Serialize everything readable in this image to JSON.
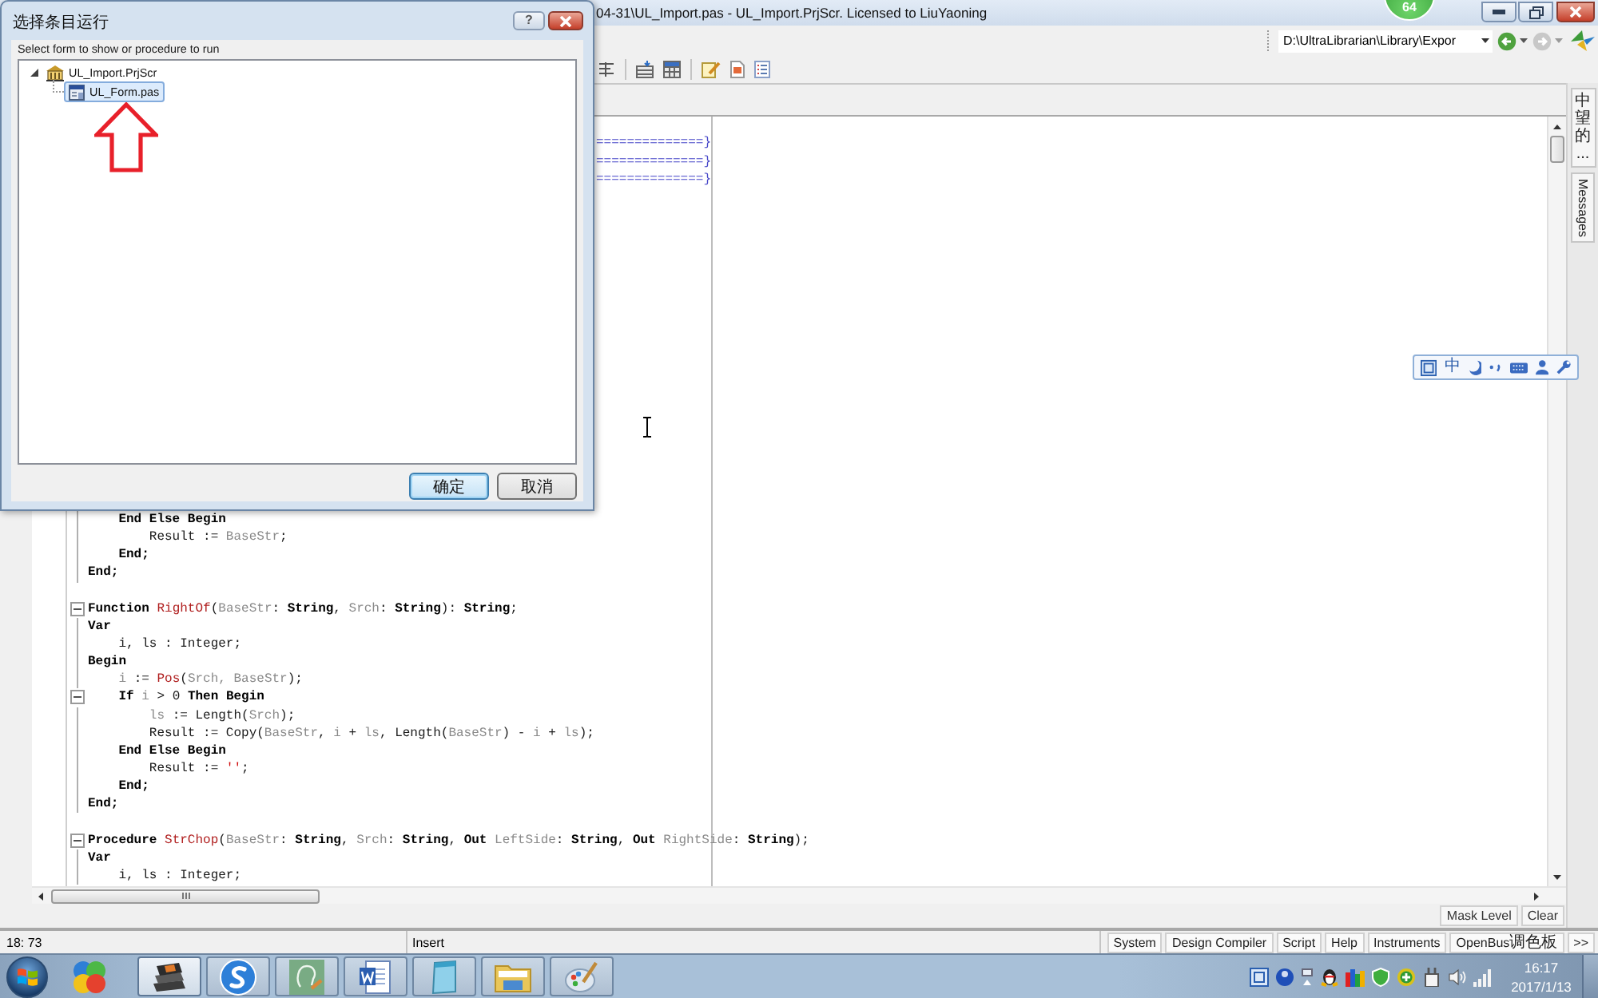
{
  "dialog": {
    "title": "选择条目运行",
    "help_button": "?",
    "prompt": "Select form to show or procedure to run",
    "tree": [
      {
        "label": "UL_Import.PrjScr",
        "expanded": true,
        "selected": false,
        "children": [
          {
            "label": "UL_Form.pas",
            "selected": true
          }
        ]
      }
    ],
    "buttons": [
      {
        "label": "确定",
        "default": true
      },
      {
        "label": "取消",
        "default": false
      }
    ]
  },
  "window": {
    "title": "04-31\\UL_Import.pas - UL_Import.PrjScr. Licensed to LiuYaoning"
  },
  "floating_badge": "64",
  "toolbar": {
    "path_field": {
      "value": "D:\\UltraLibrarian\\Library\\Expor"
    }
  },
  "editor": {
    "fragments": [
      "==============}",
      "==============}",
      "==============}"
    ],
    "blocks": [
      [
        {
          "fold": false,
          "tokens": [
            {
              "kind": "keyword",
              "text": "    End Else Begin"
            }
          ]
        },
        {
          "fold": false,
          "tokens": [
            {
              "kind": "plain",
              "text": "        Result := "
            },
            {
              "kind": "identifier",
              "text": "BaseStr"
            },
            {
              "kind": "plain",
              "text": ";"
            }
          ]
        },
        {
          "fold": false,
          "tokens": [
            {
              "kind": "keyword",
              "text": "    End;"
            }
          ]
        },
        {
          "fold": false,
          "tokens": [
            {
              "kind": "keyword",
              "text": "End;"
            }
          ]
        }
      ],
      [
        {
          "fold": true,
          "tokens": [
            {
              "kind": "keyword",
              "text": "Function "
            },
            {
              "kind": "function",
              "text": "RightOf"
            },
            {
              "kind": "plain",
              "text": "("
            },
            {
              "kind": "identifier",
              "text": "BaseStr"
            },
            {
              "kind": "plain",
              "text": ": "
            },
            {
              "kind": "keyword",
              "text": "String"
            },
            {
              "kind": "plain",
              "text": ", "
            },
            {
              "kind": "identifier",
              "text": "Srch"
            },
            {
              "kind": "plain",
              "text": ": "
            },
            {
              "kind": "keyword",
              "text": "String"
            },
            {
              "kind": "plain",
              "text": "): "
            },
            {
              "kind": "keyword",
              "text": "String"
            },
            {
              "kind": "plain",
              "text": ";"
            }
          ]
        },
        {
          "fold": false,
          "tokens": [
            {
              "kind": "keyword",
              "text": "Var"
            }
          ]
        },
        {
          "fold": false,
          "tokens": [
            {
              "kind": "plain",
              "text": "    i, ls : Integer;"
            }
          ]
        },
        {
          "fold": false,
          "tokens": [
            {
              "kind": "keyword",
              "text": "Begin"
            }
          ]
        },
        {
          "fold": false,
          "tokens": [
            {
              "kind": "identifier",
              "text": "    i"
            },
            {
              "kind": "plain",
              "text": " := "
            },
            {
              "kind": "function",
              "text": "Pos"
            },
            {
              "kind": "plain",
              "text": "("
            },
            {
              "kind": "identifier",
              "text": "Srch, BaseStr"
            },
            {
              "kind": "plain",
              "text": ");"
            }
          ]
        },
        {
          "fold": true,
          "tokens": [
            {
              "kind": "keyword",
              "text": "    If "
            },
            {
              "kind": "identifier",
              "text": "i"
            },
            {
              "kind": "plain",
              "text": " > 0 "
            },
            {
              "kind": "keyword",
              "text": "Then Begin"
            }
          ]
        },
        {
          "fold": false,
          "tokens": [
            {
              "kind": "identifier",
              "text": "        ls"
            },
            {
              "kind": "plain",
              "text": " := Length("
            },
            {
              "kind": "identifier",
              "text": "Srch"
            },
            {
              "kind": "plain",
              "text": ");"
            }
          ]
        },
        {
          "fold": false,
          "tokens": [
            {
              "kind": "plain",
              "text": "        Result := Copy("
            },
            {
              "kind": "identifier",
              "text": "BaseStr"
            },
            {
              "kind": "plain",
              "text": ", "
            },
            {
              "kind": "identifier",
              "text": "i"
            },
            {
              "kind": "plain",
              "text": " + "
            },
            {
              "kind": "identifier",
              "text": "ls"
            },
            {
              "kind": "plain",
              "text": ", Length("
            },
            {
              "kind": "identifier",
              "text": "BaseStr"
            },
            {
              "kind": "plain",
              "text": ") - "
            },
            {
              "kind": "identifier",
              "text": "i"
            },
            {
              "kind": "plain",
              "text": " + "
            },
            {
              "kind": "identifier",
              "text": "ls"
            },
            {
              "kind": "plain",
              "text": ");"
            }
          ]
        },
        {
          "fold": false,
          "tokens": [
            {
              "kind": "keyword",
              "text": "    End Else Begin"
            }
          ]
        },
        {
          "fold": false,
          "tokens": [
            {
              "kind": "plain",
              "text": "        Result := "
            },
            {
              "kind": "string",
              "text": "''"
            },
            {
              "kind": "plain",
              "text": ";"
            }
          ]
        },
        {
          "fold": false,
          "tokens": [
            {
              "kind": "keyword",
              "text": "    End;"
            }
          ]
        },
        {
          "fold": false,
          "tokens": [
            {
              "kind": "keyword",
              "text": "End;"
            }
          ]
        }
      ],
      [
        {
          "fold": true,
          "tokens": [
            {
              "kind": "keyword",
              "text": "Procedure "
            },
            {
              "kind": "function",
              "text": "StrChop"
            },
            {
              "kind": "plain",
              "text": "("
            },
            {
              "kind": "identifier",
              "text": "BaseStr"
            },
            {
              "kind": "plain",
              "text": ": "
            },
            {
              "kind": "keyword",
              "text": "String"
            },
            {
              "kind": "plain",
              "text": ", "
            },
            {
              "kind": "identifier",
              "text": "Srch"
            },
            {
              "kind": "plain",
              "text": ": "
            },
            {
              "kind": "keyword",
              "text": "String"
            },
            {
              "kind": "plain",
              "text": ", "
            },
            {
              "kind": "keyword",
              "text": "Out "
            },
            {
              "kind": "identifier",
              "text": "LeftSide"
            },
            {
              "kind": "plain",
              "text": ": "
            },
            {
              "kind": "keyword",
              "text": "String"
            },
            {
              "kind": "plain",
              "text": ", "
            },
            {
              "kind": "keyword",
              "text": "Out "
            },
            {
              "kind": "identifier",
              "text": "RightSide"
            },
            {
              "kind": "plain",
              "text": ": "
            },
            {
              "kind": "keyword",
              "text": "String"
            },
            {
              "kind": "plain",
              "text": ");"
            }
          ]
        },
        {
          "fold": false,
          "tokens": [
            {
              "kind": "keyword",
              "text": "Var"
            }
          ]
        },
        {
          "fold": false,
          "tokens": [
            {
              "kind": "plain",
              "text": "    i, ls : Integer;"
            }
          ]
        }
      ]
    ]
  },
  "ime_toolbar": {
    "mode": "中"
  },
  "side_tabs": [
    {
      "kind": "stacked",
      "label": "中望的..."
    },
    {
      "kind": "rotated",
      "label": "Messages"
    }
  ],
  "panel_buttons": [
    "Mask Level",
    "Clear"
  ],
  "status_bar": {
    "position": "18: 73",
    "mode": "Insert",
    "panels": [
      "System",
      "Design Compiler",
      "Script",
      "Help",
      "Instruments",
      "OpenBus调色板",
      ">>"
    ]
  },
  "taskbar": {
    "apps": [
      {
        "running": false,
        "selected": false
      },
      {
        "running": true,
        "selected": true
      },
      {
        "running": true,
        "selected": false
      },
      {
        "running": true,
        "selected": false
      },
      {
        "running": true,
        "selected": false
      },
      {
        "running": true,
        "selected": false
      },
      {
        "running": true,
        "selected": false
      },
      {
        "running": true,
        "selected": false
      }
    ],
    "time": "16:17",
    "date": "2017/1/13"
  }
}
